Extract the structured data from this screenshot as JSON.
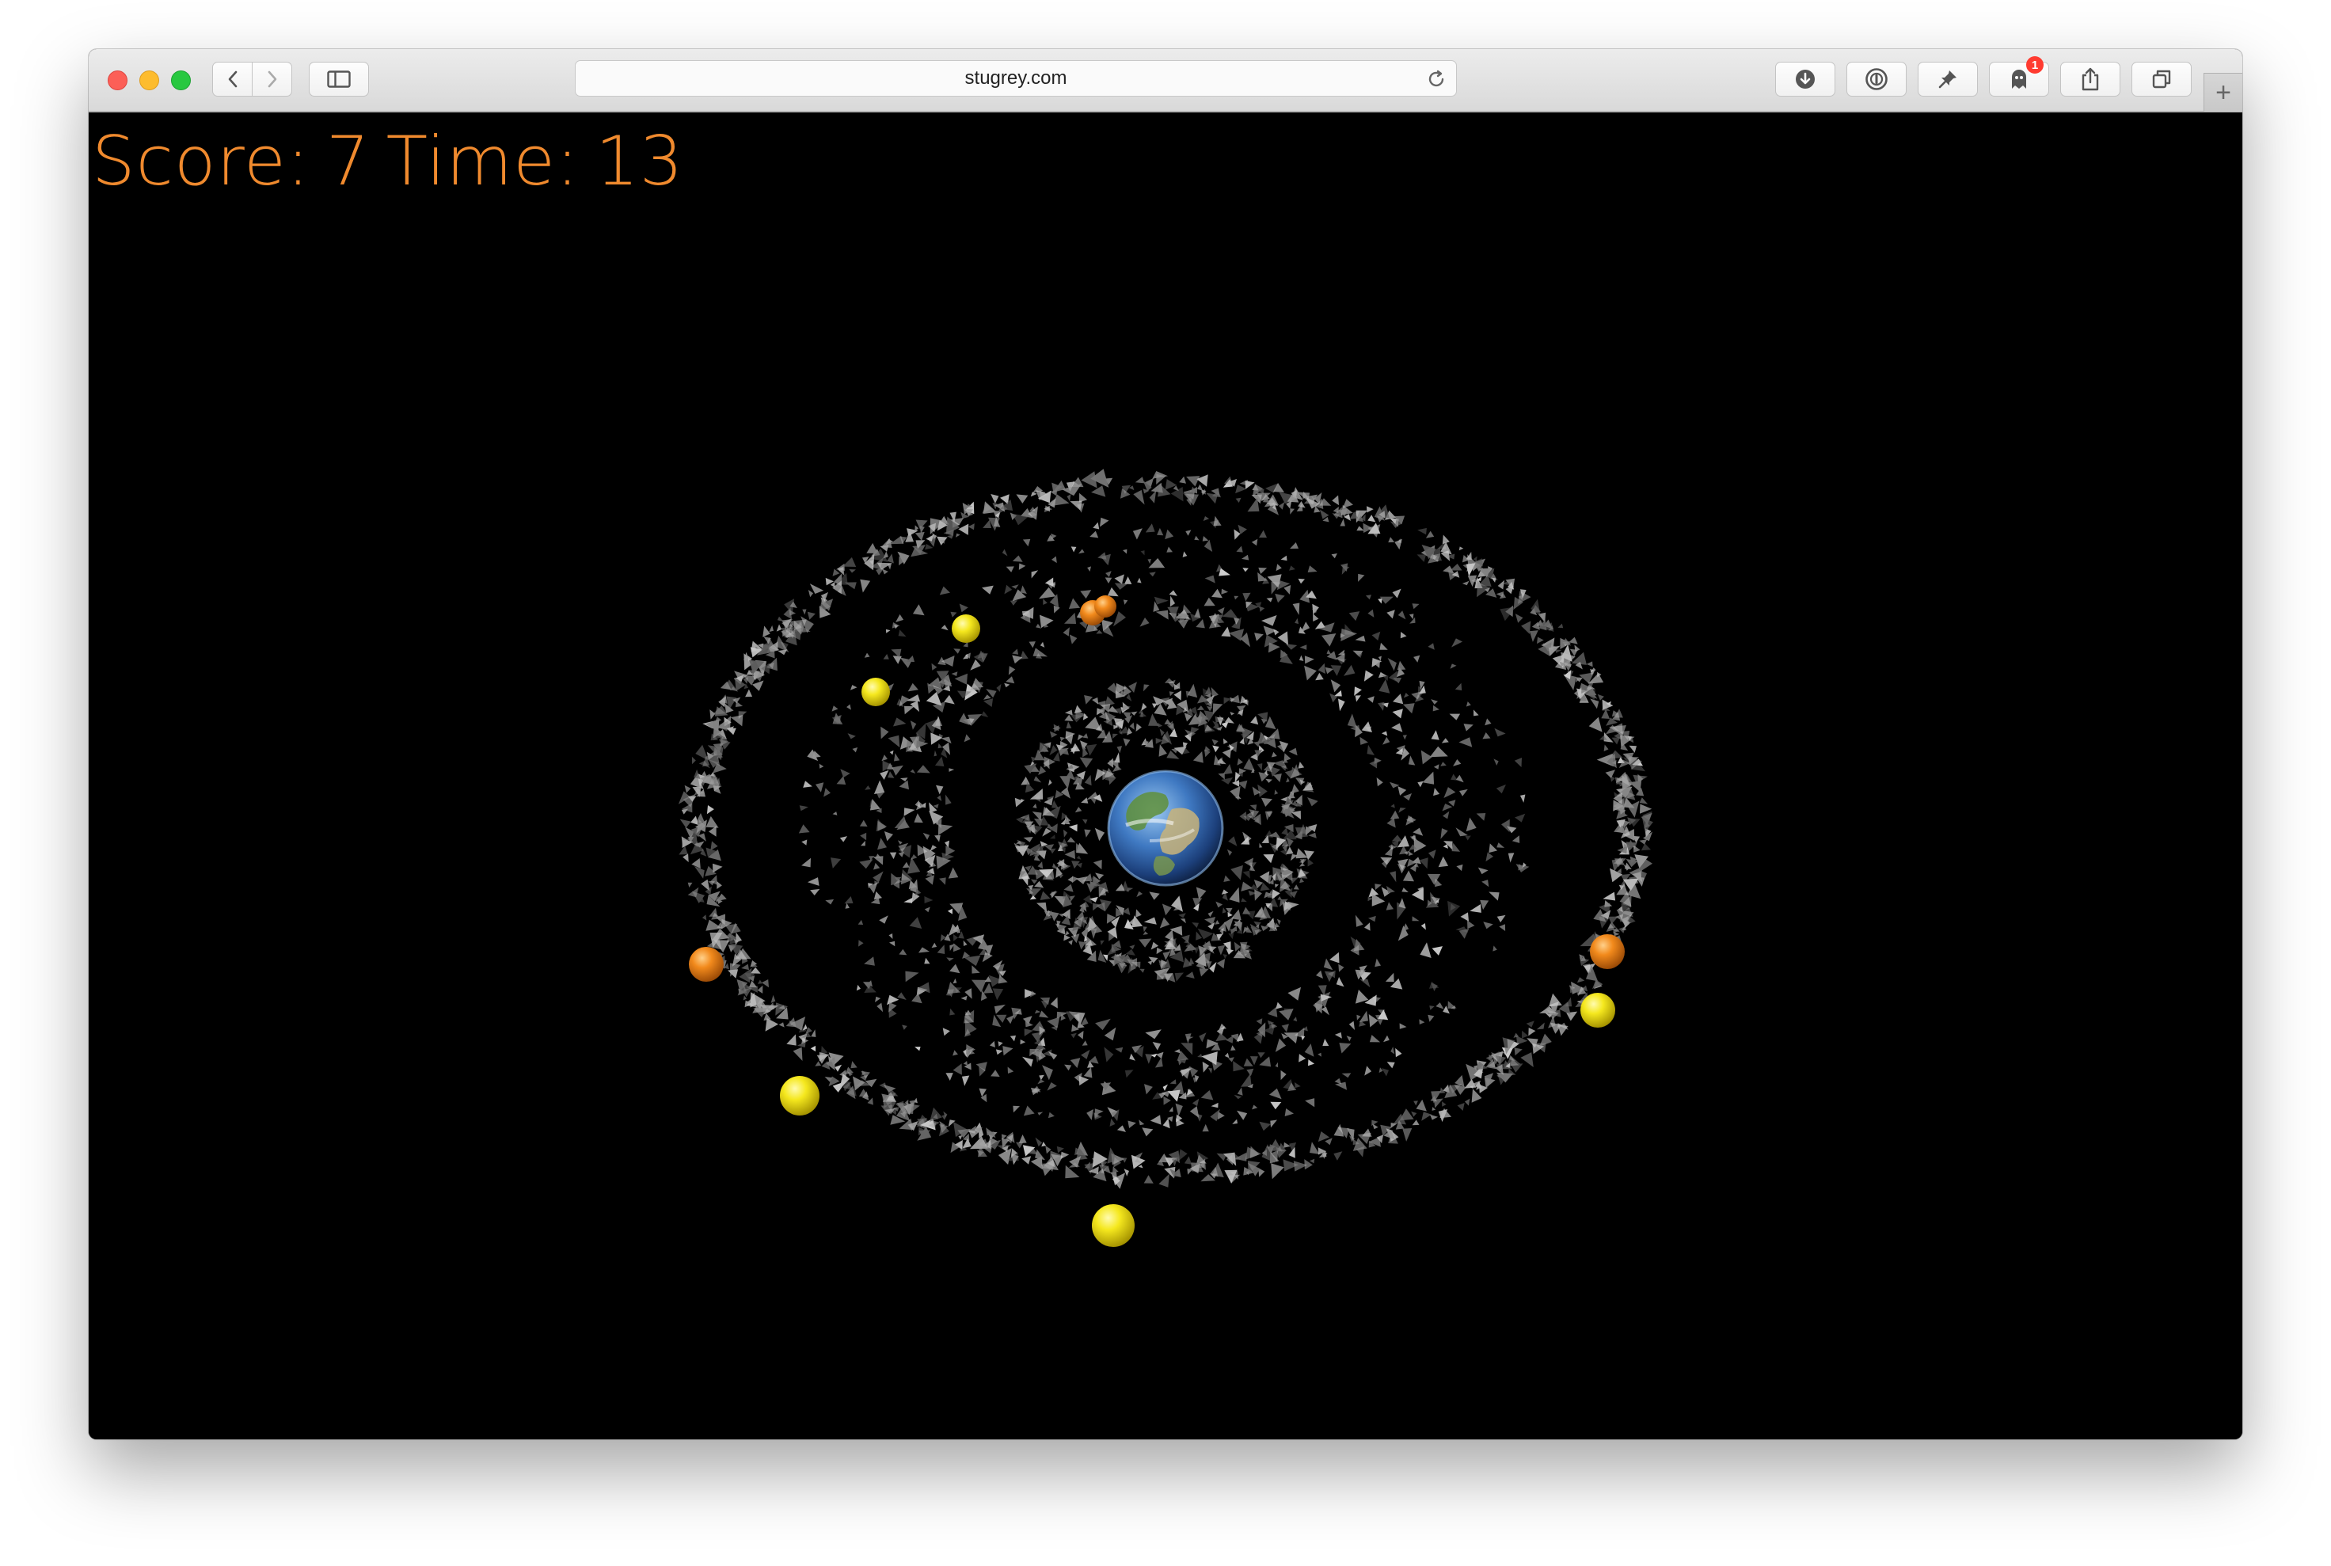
{
  "browser": {
    "url": "stugrey.com",
    "notification_count": "1",
    "toolbar_icons": [
      "download-icon",
      "password-icon",
      "pin-icon",
      "ghost-icon",
      "share-icon",
      "tabs-icon"
    ],
    "chrome_colors": {
      "close": "#fc5f57",
      "minimize": "#fdbc2e",
      "zoom": "#28c840"
    }
  },
  "hud": {
    "score_label": "Score:",
    "score_value": "7",
    "time_label": "Time:",
    "time_value": "13",
    "color": "#f08a2e"
  },
  "scene": {
    "background": "#000000",
    "planet": "earth",
    "debris_color": "#ffffff",
    "orb_colors": {
      "yellow": "#f2e21a",
      "orange": "#f08a1c"
    },
    "orbs": [
      {
        "color": "yellow"
      },
      {
        "color": "yellow"
      },
      {
        "color": "orange"
      },
      {
        "color": "orange"
      },
      {
        "color": "yellow"
      },
      {
        "color": "orange"
      },
      {
        "color": "orange"
      },
      {
        "color": "yellow"
      },
      {
        "color": "yellow"
      }
    ]
  }
}
